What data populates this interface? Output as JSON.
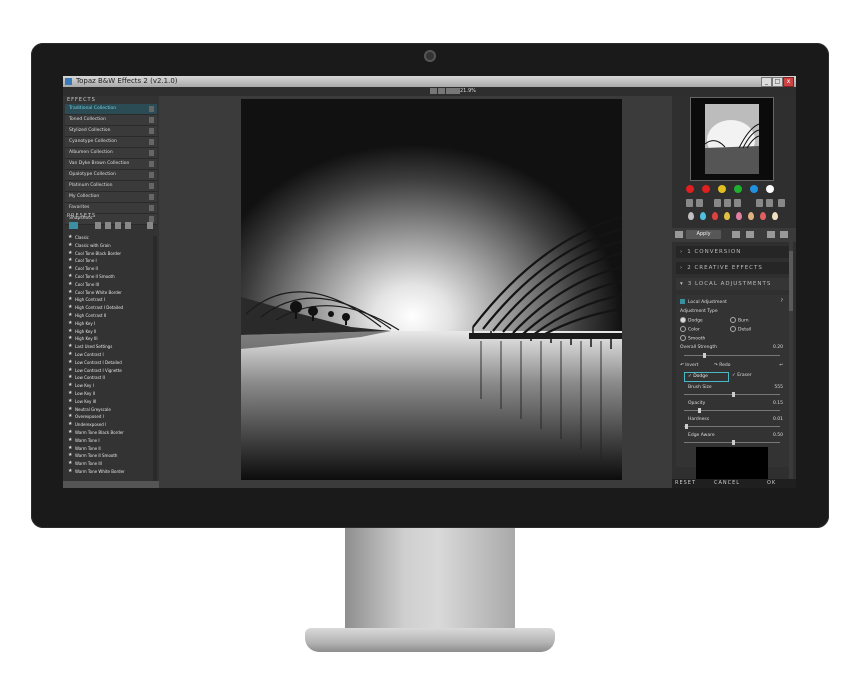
{
  "window": {
    "title": "Topaz B&W Effects 2 (v2.1.0)",
    "zoom": "21.9%",
    "buttons": {
      "minimize": "_",
      "maximize": "□",
      "close": "x"
    }
  },
  "effects": {
    "header": "EFFECTS",
    "items": [
      {
        "label": "Traditional Collection",
        "selected": true
      },
      {
        "label": "Toned Collection"
      },
      {
        "label": "Stylized Collection"
      },
      {
        "label": "Cyanotype Collection"
      },
      {
        "label": "Albumen Collection"
      },
      {
        "label": "Van Dyke Brown Collection"
      },
      {
        "label": "Opalotype Collection"
      },
      {
        "label": "Platinum Collection"
      },
      {
        "label": "My Collection"
      },
      {
        "label": "Favorites"
      },
      {
        "label": "Snapshots"
      }
    ]
  },
  "presets": {
    "header": "PRESETS",
    "items": [
      "Classic",
      "Classic with Grain",
      "Cool Tone Black Border",
      "Cool Tone I",
      "Cool Tone II",
      "Cool Tone II Smooth",
      "Cool Tone III",
      "Cool Tone White Border",
      "High Contrast I",
      "High Contrast I Detailed",
      "High Contrast II",
      "High Key I",
      "High Key II",
      "High Key III",
      "Last Used Settings",
      "Low Contrast I",
      "Low Contrast I Detailed",
      "Low Contrast I Vignette",
      "Low Contrast II",
      "Low Key I",
      "Low Key II",
      "Low Key III",
      "Neutral Greyscale",
      "Overexposed I",
      "Underexposed I",
      "Warm Tone Black Border",
      "Warm Tone I",
      "Warm Tone II",
      "Warm Tone II Smooth",
      "Warm Tone III",
      "Warm Tone White Border"
    ]
  },
  "right_panel": {
    "swatch_colors": [
      "#e02020",
      "#e02020",
      "#e0c020",
      "#20b030",
      "#2090e0",
      "#ffffff"
    ],
    "drop_colors": [
      "#c0c0c0",
      "#50c0e0",
      "#e04040",
      "#e0c040",
      "#e080a0",
      "#e0b080",
      "#e06060",
      "#f0e0c0"
    ],
    "apply_label": "Apply",
    "sections": {
      "conversion": "1 CONVERSION",
      "creative": "2 CREATIVE EFFECTS",
      "local": "3 LOCAL ADJUSTMENTS"
    },
    "local_adjustment": {
      "title": "Local Adjustment",
      "help": "?",
      "type_label": "Adjustment Type",
      "types": [
        "Dodge",
        "Burn",
        "Color",
        "Detail",
        "Smooth"
      ],
      "overall_strength_label": "Overall Strength",
      "overall_strength_value": "0.20",
      "overall_strength": 0.2,
      "invert_label": "Invert",
      "redo_label": "Redo",
      "dodge_label": "Dodge",
      "eraser_label": "Eraser",
      "brush_size_label": "Brush Size",
      "brush_size_value": "555",
      "opacity_label": "Opacity",
      "opacity_value": "0.15",
      "hardness_label": "Hardness",
      "hardness_value": "0.01",
      "edge_aware_label": "Edge Aware",
      "edge_aware_value": "0.50"
    },
    "bottom": {
      "reset": "RESET",
      "cancel": "CANCEL",
      "ok": "OK"
    }
  }
}
